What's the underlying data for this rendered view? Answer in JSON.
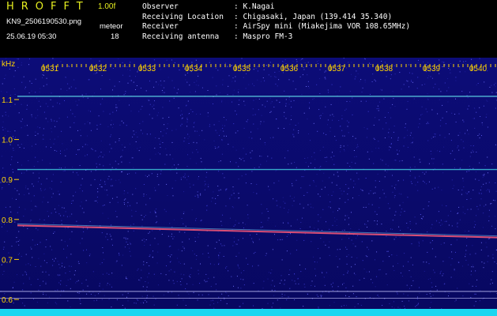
{
  "header": {
    "app_title": "HROFFT",
    "version": "1.00f",
    "filename": "KN9_2506190530.png",
    "mode": "meteor",
    "datetime": "25.06.19 05:30",
    "count": "18"
  },
  "station": [
    {
      "key": "Observer",
      "value": ": K.Nagai"
    },
    {
      "key": "Receiving Location",
      "value": ": Chigasaki, Japan (139.414 35.340)"
    },
    {
      "key": "Receiver",
      "value": ": AirSpy mini (Miakejima VOR 108.65MHz)"
    },
    {
      "key": "Receiving antenna",
      "value": ": Maspro FM-3"
    }
  ],
  "axis": {
    "y_unit": "kHz",
    "y_ticks": [
      "1.1",
      "1.0",
      "0.9",
      "0.8",
      "0.7",
      "0.6"
    ],
    "x_ticks": [
      "0531",
      "0532",
      "0533",
      "0534",
      "0535",
      "0536",
      "0537",
      "0538",
      "0539",
      "0540"
    ]
  },
  "colors": {
    "background": "#000000",
    "waterfall": "#0a0a6e",
    "label": "#ffd400",
    "title": "#e8f020",
    "trace": "#ff5a78",
    "carrier": "#40d0e0"
  }
}
